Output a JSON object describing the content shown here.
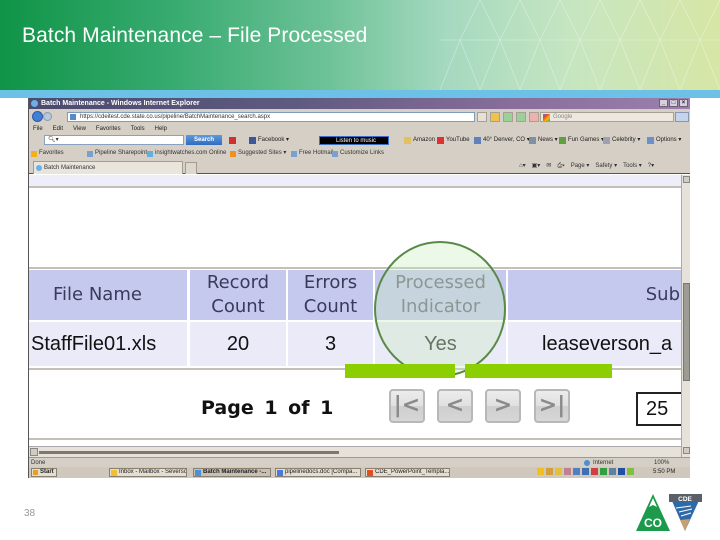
{
  "slide": {
    "title": "Batch Maintenance – File Processed",
    "page_number": "38"
  },
  "browser": {
    "window_title": "Batch Maintenance - Windows Internet Explorer",
    "window_buttons": [
      "_",
      "□",
      "×"
    ],
    "address_url": "https://cdeitest.cde.state.co.us/pipeline/BatchMaintenance_search.aspx",
    "search_placeholder": "Google",
    "menu": [
      "File",
      "Edit",
      "View",
      "Favorites",
      "Tools",
      "Help"
    ],
    "toolbar": {
      "search_value": "",
      "search_button": "Search",
      "items": [
        "Facebook ▾",
        "Amazon",
        "YouTube",
        "40° Denver, CO ▾",
        "News ▾",
        "Fun Games ▾",
        "Celebrity ▾",
        "Options ▾"
      ],
      "listen_label": "Listen to music"
    },
    "favorites": {
      "label": "Favorites",
      "items": [
        "Pipeline Sharepoint",
        "insightwatches.com Online",
        "Suggested Sites ▾",
        "Free Hotmail",
        "Customize Links"
      ]
    },
    "tab_label": "Batch Maintenance",
    "command_bar": [
      "Page ▾",
      "Safety ▾",
      "Tools ▾",
      "?▾"
    ],
    "status_text": "Done",
    "status_zone": "Internet",
    "status_zoom": "100%",
    "taskbar": {
      "start_label": "Start",
      "items": [
        "Inbox - Mailbox - Severso...",
        "Batch Maintenance -...",
        "pipelinedocs.doc [Compa...",
        "CDE_PowerPoint_Templa..."
      ],
      "clock": "5:50 PM"
    }
  },
  "grid": {
    "columns": [
      {
        "label": "File Name"
      },
      {
        "label": "Record\nCount"
      },
      {
        "label": "Errors\nCount"
      },
      {
        "label": "Processed\nIndicator"
      },
      {
        "label": "Sub"
      }
    ],
    "rows": [
      [
        "StaffFile01.xls",
        "20",
        "3",
        "Yes",
        "leaseverson_a"
      ]
    ]
  },
  "pager": {
    "text": "Page 1 of 1",
    "first_icon": "first-page-icon",
    "prev_icon": "previous-page-icon",
    "next_icon": "next-page-icon",
    "last_icon": "last-page-icon",
    "page_size": "25"
  },
  "logo": {
    "text_co": "CO",
    "text_cde": "CDE"
  },
  "colors": {
    "banner_green": "#0f9447",
    "stripe_blue": "#6ec1e6",
    "grid_header": "#c5c9ee",
    "grid_row": "#eaeaf8",
    "highlight": "#5a8a48",
    "progress_green": "#8ccf00"
  }
}
